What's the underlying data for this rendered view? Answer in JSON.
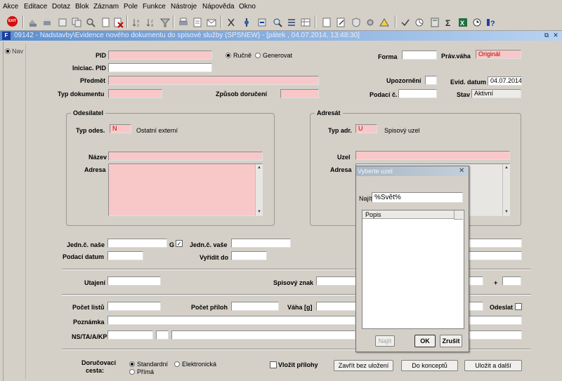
{
  "menu": [
    "Akce",
    "Editace",
    "Dotaz",
    "Blok",
    "Záznam",
    "Pole",
    "Funkce",
    "Nástroje",
    "Nápověda",
    "Okno"
  ],
  "toolbar": {
    "exit_label": "EXIT"
  },
  "window": {
    "icon_text": "F",
    "title": "09142 - Nadstavby\\Evidence nového dokumentu do spisové služby (SPSNEW) - [pátek , 04.07.2014, 13:48:30]",
    "restore_symbol": "⧉",
    "close_symbol": "✕"
  },
  "nav": {
    "label": "Nav"
  },
  "form": {
    "pid_label": "PID",
    "pid_value": "",
    "mode_manual": "Ručně",
    "mode_generate": "Generovat",
    "forma_label": "Forma",
    "forma_value": "",
    "prav_vaha_label": "Práv.váha",
    "prav_vaha_value": "Originál",
    "iniciac_pid_label": "Iniciac. PID",
    "iniciac_pid_value": "",
    "predmet_label": "Předmět",
    "predmet_value": "",
    "upozorneni_label": "Upozornění",
    "evid_datum_label": "Evid. datum",
    "evid_datum_value": "04.07.2014",
    "typ_dokumentu_label": "Typ dokumentu",
    "zpusob_doruceni_label": "Způsob doručení",
    "podaci_c_label": "Podací č.",
    "stav_label": "Stav",
    "stav_value": "Aktivní",
    "odesilatel": {
      "title": "Odesílatel",
      "typ_label": "Typ odes.",
      "typ_value": "N",
      "typ_text": "Ostatní externí",
      "nazev_label": "Název",
      "adresa_label": "Adresa"
    },
    "adresat": {
      "title": "Adresát",
      "typ_label": "Typ adr.",
      "typ_value": "U",
      "typ_text": "Spisový uzel",
      "uzel_label": "Uzel",
      "adresa_label": "Adresa"
    },
    "jedn_nase_label": "Jedn.č. naše",
    "g_label": "G",
    "g_check": "✓",
    "jedn_vase_label": "Jedn.č. vaše",
    "podaci_datum_label": "Podací datum",
    "vyridit_do_label": "Vyřídit do",
    "utajeni_label": "Utajení",
    "spisovy_znak_label": "Spisový znak",
    "plus_label": "+",
    "pocet_listu_label": "Počet listů",
    "pocet_priloh_label": "Počet příloh",
    "vaha_label": "Váha [g]",
    "odeslat_label": "Odeslat",
    "poznamka_label": "Poznámka",
    "ns_label": "NS/TA/A/KP",
    "doruc_cesta_label_1": "Doručovací",
    "doruc_cesta_label_2": "cesta:",
    "doruc_standard": "Standardní",
    "doruc_elektronicka": "Elektronická",
    "doruc_prima": "Přímá",
    "vlozit_prilohy": "Vložit přílohy",
    "btn_zavrit": "Zavřít bez uložení",
    "btn_koncept": "Do konceptů",
    "btn_ulozit": "Uložit a další"
  },
  "dialog": {
    "title": "Vyberte uzel",
    "close_symbol": "✕",
    "najit_label": "Najít",
    "search_value": "%Svět%",
    "column_header": "Popis",
    "btn_najit": "Najít",
    "btn_ok": "OK",
    "btn_zrusit": "Zrušit"
  }
}
